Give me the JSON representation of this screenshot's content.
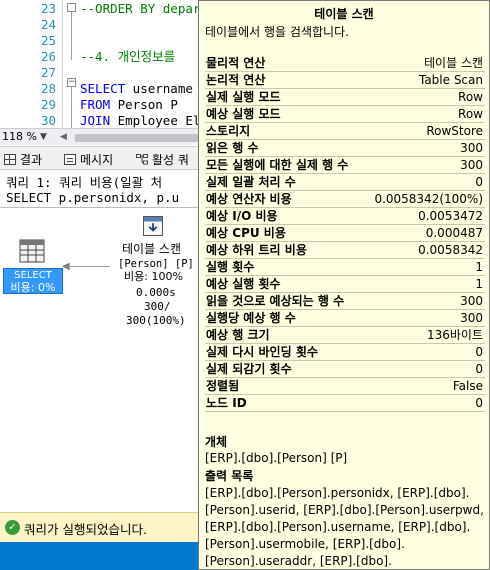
{
  "editor": {
    "lines": [
      {
        "num": "23",
        "text": "--ORDER BY depar",
        "kind": "comment"
      },
      {
        "num": "24",
        "text": "",
        "kind": "txt"
      },
      {
        "num": "25",
        "text": "",
        "kind": "txt"
      },
      {
        "num": "26",
        "text": "--4. 개인정보를",
        "kind": "comment"
      },
      {
        "num": "27",
        "text": "",
        "kind": "txt"
      },
      {
        "num": "28",
        "text": "SELECT username",
        "kind": "kw"
      },
      {
        "num": "29",
        "text": "FROM Person P",
        "kind": "kw"
      },
      {
        "num": "30",
        "text": "JOIN Employee El",
        "kind": "kw"
      }
    ]
  },
  "zoom": {
    "value": "118 %"
  },
  "results_tabs": {
    "results": "결과",
    "messages": "메시지",
    "plan": "활성 쿼"
  },
  "plan": {
    "query_header": "쿼리 1: 쿼리 비용(일괄 처",
    "query_sql": "SELECT p.personidx, p.u",
    "select_node": {
      "label": "SELECT",
      "cost": "비용: 0%"
    },
    "scan_node": {
      "label": "테이블 스캔",
      "object": "[Person] [P]",
      "cost": "비용: 100%",
      "time": "0.000s",
      "rows_a": "300/",
      "rows_b": "300(100%)"
    }
  },
  "status": {
    "message": "쿼리가 실행되었습니다."
  },
  "tooltip": {
    "title": "테이블 스캔",
    "description": "테이블에서 행을 검색합니다.",
    "rows": [
      {
        "key": "물리적 연산",
        "value": "테이블 스캔"
      },
      {
        "key": "논리적 연산",
        "value": "Table Scan"
      },
      {
        "key": "실제 실행 모드",
        "value": "Row"
      },
      {
        "key": "예상 실행 모드",
        "value": "Row"
      },
      {
        "key": "스토리지",
        "value": "RowStore"
      },
      {
        "key": "읽은 행 수",
        "value": "300"
      },
      {
        "key": "모든 실행에 대한 실제 행 수",
        "value": "300"
      },
      {
        "key": "실제 일괄 처리 수",
        "value": "0"
      },
      {
        "key": "예상 연산자 비용",
        "value": "0.0058342(100%)"
      },
      {
        "key": "예상 I/O 비용",
        "value": "0.0053472"
      },
      {
        "key": "예상 CPU 비용",
        "value": "0.000487"
      },
      {
        "key": "예상 하위 트리 비용",
        "value": "0.0058342"
      },
      {
        "key": "실행 횟수",
        "value": "1"
      },
      {
        "key": "예상 실행 횟수",
        "value": "1"
      },
      {
        "key": "읽을 것으로 예상되는 행 수",
        "value": "300"
      },
      {
        "key": "실행당 예상 행 수",
        "value": "300"
      },
      {
        "key": "예상 행 크기",
        "value": "136바이트"
      },
      {
        "key": "실제 다시 바인딩 횟수",
        "value": "0"
      },
      {
        "key": "실제 되감기 횟수",
        "value": "0"
      },
      {
        "key": "정렬됨",
        "value": "False"
      },
      {
        "key": "노드 ID",
        "value": "0"
      }
    ],
    "object_label": "개체",
    "object_value": "[ERP].[dbo].[Person] [P]",
    "output_label": "출력 목록",
    "output_lines": [
      "[ERP].[dbo].[Person].personidx, [ERP].[dbo].",
      "[Person].userid, [ERP].[dbo].[Person].userpwd,",
      "[ERP].[dbo].[Person].username, [ERP].[dbo].",
      "[Person].usermobile, [ERP].[dbo].",
      "[Person].useraddr, [ERP].[dbo].[Person].useremail"
    ]
  },
  "colors": {
    "accent": "#007acc",
    "selection": "#3399ff",
    "tooltip_bg": "#ffffe1",
    "status_bg": "#fcf4c7",
    "comment": "#008000",
    "keyword": "#0000ff"
  }
}
